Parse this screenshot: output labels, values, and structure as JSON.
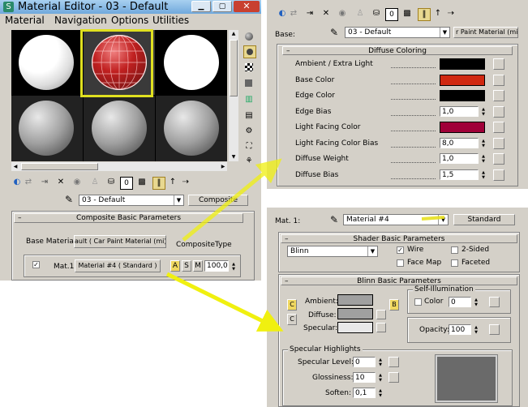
{
  "window": {
    "title": "Material Editor - 03 - Default",
    "menu": [
      "Material",
      "Navigation",
      "Options",
      "Utilities"
    ]
  },
  "left": {
    "material_name": "03 - Default",
    "type_button": "Composite",
    "rollout_title": "Composite Basic Parameters",
    "base_material_label": "Base Material:",
    "base_material_value": "ault  ( Car Paint Material (mi) )",
    "composite_type_label": "CompositeType",
    "mat1_label": "Mat.1:",
    "mat1_value": "Material #4  ( Standard )",
    "mode_buttons": [
      "A",
      "S",
      "M"
    ],
    "amount": "100,0"
  },
  "top_right": {
    "base_label": "Base:",
    "base_value": "03 - Default",
    "type_label": "r Paint Material (mi)",
    "rollout_title": "Diffuse Coloring",
    "params": [
      {
        "label": "Ambient / Extra Light",
        "kind": "color",
        "color": "#000000"
      },
      {
        "label": "Base Color",
        "kind": "color",
        "color": "#d02810"
      },
      {
        "label": "Edge Color",
        "kind": "color",
        "color": "#000000"
      },
      {
        "label": "Edge Bias",
        "kind": "value",
        "value": "1,0"
      },
      {
        "label": "Light Facing Color",
        "kind": "color",
        "color": "#a00038"
      },
      {
        "label": "Light Facing Color Bias",
        "kind": "value",
        "value": "8,0"
      },
      {
        "label": "Diffuse Weight",
        "kind": "value",
        "value": "1,0"
      },
      {
        "label": "Diffuse Bias",
        "kind": "value",
        "value": "1,5"
      }
    ]
  },
  "bottom_right": {
    "mat_label": "Mat. 1:",
    "mat_value": "Material #4",
    "type_button": "Standard",
    "shader_rollout": "Shader Basic Parameters",
    "shader": "Blinn",
    "wire_label": "Wire",
    "two_sided_label": "2-Sided",
    "face_map_label": "Face Map",
    "faceted_label": "Faceted",
    "blinn_rollout": "Blinn Basic Parameters",
    "self_illum_group": "Self-Illumination",
    "color_label": "Color",
    "color_value": "0",
    "ambient_label": "Ambient:",
    "diffuse_label": "Diffuse:",
    "specular_label": "Specular:",
    "opacity_label": "Opacity:",
    "opacity_value": "100",
    "spec_group": "Specular Highlights",
    "spec_level_label": "Specular Level:",
    "spec_level_value": "0",
    "glossiness_label": "Glossiness:",
    "glossiness_value": "10",
    "soften_label": "Soften:",
    "soften_value": "0,1",
    "lock_button": "B",
    "c_button": "C"
  },
  "colors": {
    "highlight": "#e0e020",
    "arrow": "#f0f010",
    "panel_bg": "#d4d0c8",
    "title_bar": "#78b4e8",
    "close": "#c84030"
  }
}
